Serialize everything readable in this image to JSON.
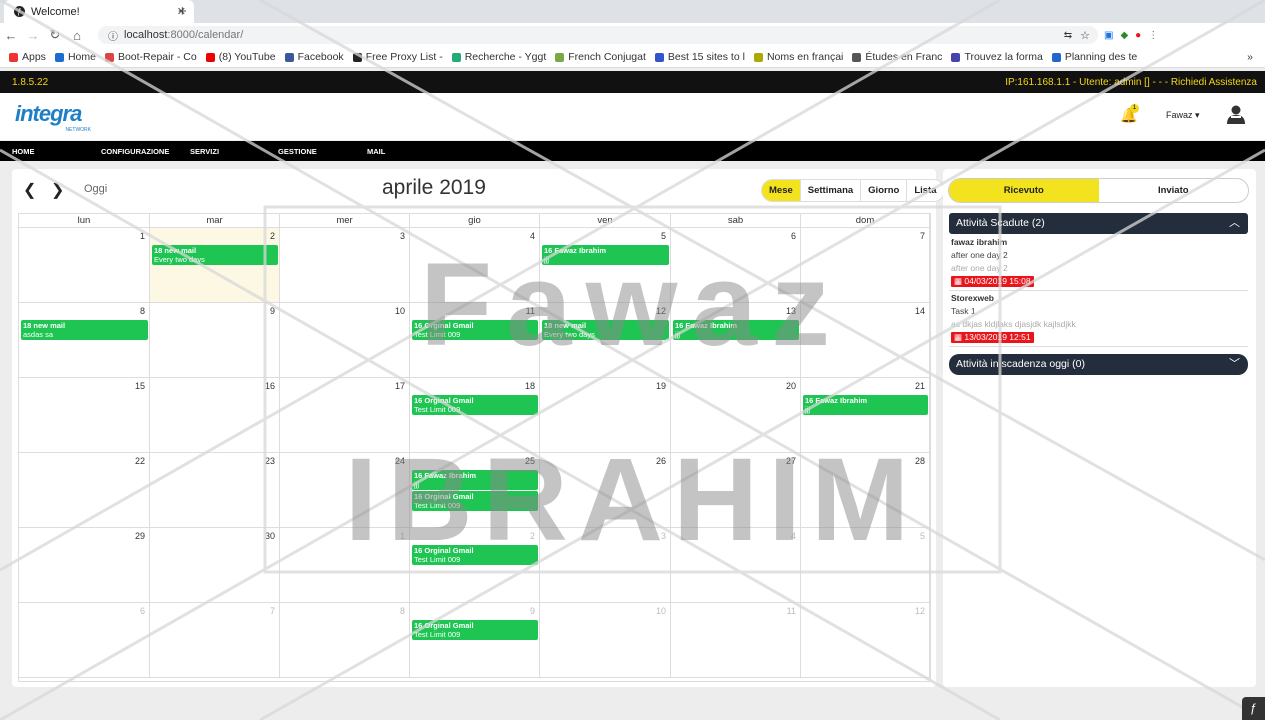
{
  "browser": {
    "tab_title": "Welcome!",
    "url_host": "localhost",
    "url_path": ":8000/calendar/",
    "bookmarks": [
      "Apps",
      "Home",
      "Boot-Repair - Co",
      "(8) YouTube",
      "Facebook",
      "Free Proxy List -",
      "Recherche - Yggt",
      "French Conjugat",
      "Best 15 sites to l",
      "Noms en françai",
      "Études en Franc",
      "Trouvez la forma",
      "Planning des te"
    ],
    "bookmark_overflow": "»"
  },
  "app": {
    "version": "1.8.5.22",
    "status": "IP:161.168.1.1 - Utente: admin [] - - - Richiedi Assistenza",
    "logo_text": "integra",
    "logo_sub": "NETWORK",
    "notif_count": "1",
    "user_name": "Fawaz",
    "menu": [
      "HOME",
      "CONFIGURAZIONE",
      "SERVIZI",
      "GESTIONE",
      "MAIL"
    ]
  },
  "calendar": {
    "today_label": "Oggi",
    "title": "aprile 2019",
    "views": [
      "Mese",
      "Settimana",
      "Giorno",
      "Lista"
    ],
    "active_view": "Mese",
    "weekdays": [
      "lun",
      "mar",
      "mer",
      "gio",
      "ven",
      "sab",
      "dom"
    ],
    "weeks": [
      [
        "1",
        "2",
        "3",
        "4",
        "5",
        "6",
        "7"
      ],
      [
        "8",
        "9",
        "10",
        "11",
        "12",
        "13",
        "14"
      ],
      [
        "15",
        "16",
        "17",
        "18",
        "19",
        "20",
        "21"
      ],
      [
        "22",
        "23",
        "24",
        "25",
        "26",
        "27",
        "28"
      ],
      [
        "29",
        "30",
        "1",
        "2",
        "3",
        "4",
        "5"
      ],
      [
        "6",
        "7",
        "8",
        "9",
        "10",
        "11",
        "12"
      ]
    ],
    "events": [
      {
        "week": 0,
        "day": 1,
        "slot": 0,
        "title": "18 new mail",
        "sub": "Every two days"
      },
      {
        "week": 0,
        "day": 4,
        "slot": 0,
        "title": "16 Fawaz Ibrahim",
        "sub": "jjj"
      },
      {
        "week": 1,
        "day": 0,
        "slot": 0,
        "title": "18 new mail",
        "sub": "asdas sa"
      },
      {
        "week": 1,
        "day": 3,
        "slot": 0,
        "title": "16 Orginal Gmail",
        "sub": "Test Limit 009"
      },
      {
        "week": 1,
        "day": 4,
        "slot": 0,
        "title": "18 new mail",
        "sub": "Every two days"
      },
      {
        "week": 1,
        "day": 5,
        "slot": 0,
        "title": "16 Fawaz Ibrahim",
        "sub": "jjj"
      },
      {
        "week": 2,
        "day": 3,
        "slot": 0,
        "title": "16 Orginal Gmail",
        "sub": "Test Limit 009"
      },
      {
        "week": 2,
        "day": 6,
        "slot": 0,
        "title": "16 Fawaz Ibrahim",
        "sub": "jjj"
      },
      {
        "week": 3,
        "day": 3,
        "slot": 0,
        "title": "16 Fawaz Ibrahim",
        "sub": "jjj"
      },
      {
        "week": 3,
        "day": 3,
        "slot": 1,
        "title": "16 Orginal Gmail",
        "sub": "Test Limit 009"
      },
      {
        "week": 4,
        "day": 3,
        "slot": 0,
        "title": "16 Orginal Gmail",
        "sub": "Test Limit 009"
      },
      {
        "week": 5,
        "day": 3,
        "slot": 0,
        "title": "16 Orginal Gmail",
        "sub": "Test Limit 009"
      }
    ]
  },
  "side": {
    "tabs": [
      "Ricevuto",
      "Inviato"
    ],
    "active_tab": "Ricevuto",
    "overdue_title": "Attività Scadute (2)",
    "tasks": [
      {
        "name": "fawaz ibrahim",
        "desc": "after one day 2",
        "note": "after one day 2",
        "date": "04/03/2019 15:08"
      },
      {
        "name": "Storexweb",
        "desc": "Task 1",
        "note": "as dkjas kldjlaks djasjdk kajlsdjkk",
        "date": "13/03/2019 12:51"
      }
    ],
    "today_title": "Attività in scadenza oggi (0)"
  },
  "watermark": {
    "line1": "Fawaz",
    "line2": "IBRAHIM"
  },
  "colors": {
    "accent": "#f3e21e",
    "event": "#1ec553",
    "header": "#242d3b",
    "danger": "#e8151b"
  }
}
